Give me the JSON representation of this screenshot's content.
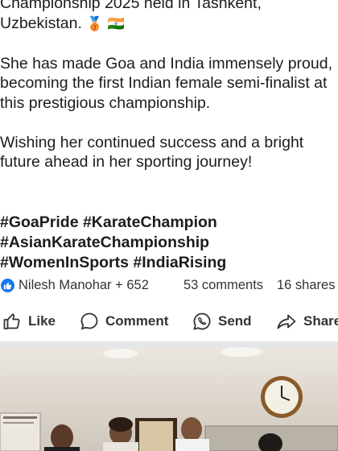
{
  "post": {
    "line1": "Championship 2025 held in Tashkent,",
    "line2": "Uzbekistan.",
    "line2_emoji_medal": "🥉",
    "line2_emoji_flag": "🇮🇳",
    "para2": "She has made Goa and India immensely proud, becoming the first Indian female semi-finalist at this prestigious championship.",
    "para3": "Wishing her continued success and a bright future ahead in her sporting journey!",
    "hashtags": [
      "#GoaPride #KarateChampion",
      "#AsianKarateChampionship",
      "#WomenInSports #IndiaRising"
    ]
  },
  "reactions": {
    "names": "Nilesh Manohar + 652",
    "comments": "53 comments",
    "shares": "16 shares",
    "icon": "thumbs-up-icon",
    "icon_color": "#1877f2"
  },
  "actions": {
    "like": "Like",
    "comment": "Comment",
    "send": "Send",
    "share": "Share"
  }
}
